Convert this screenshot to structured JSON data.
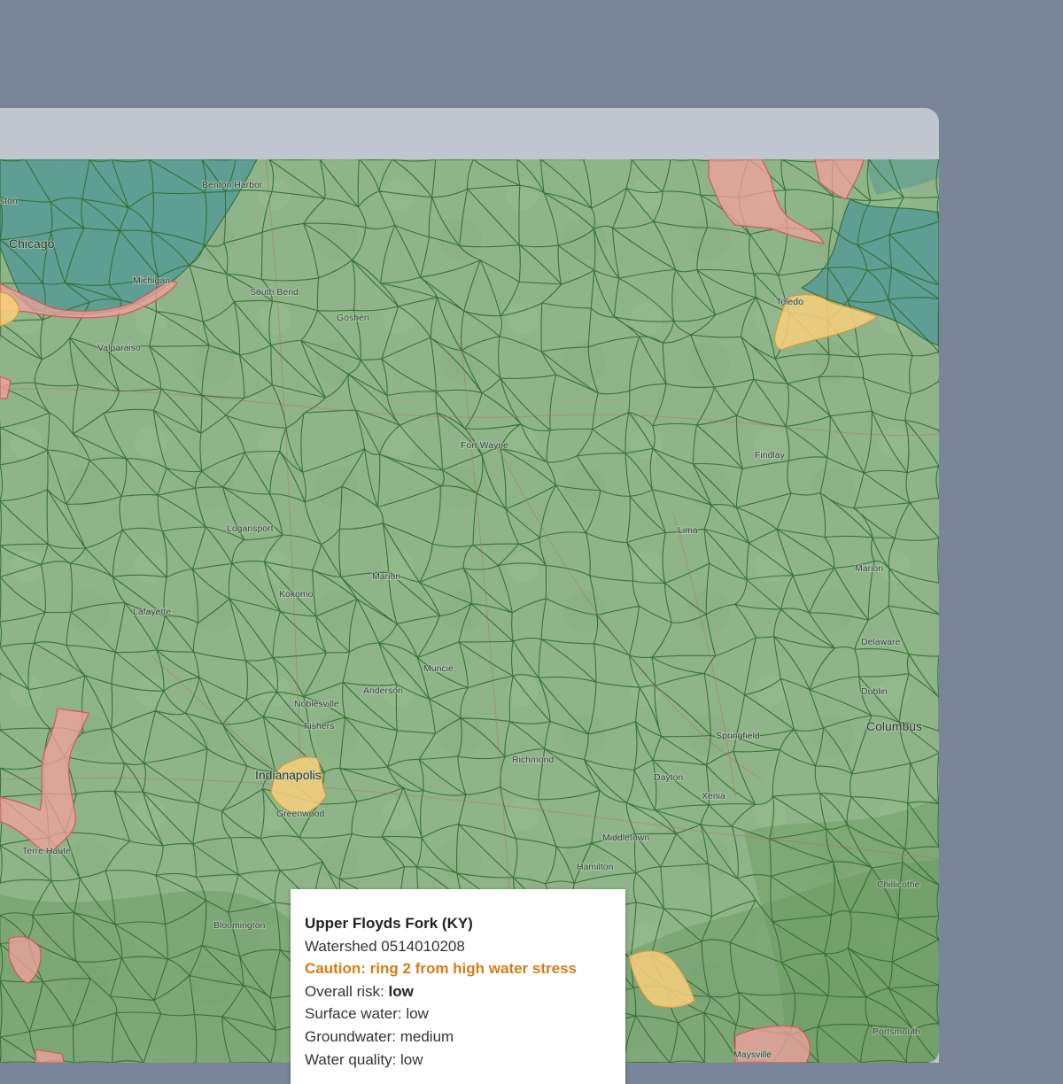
{
  "map": {
    "colors": {
      "base": "#8fb489",
      "lake": "#5e9e93",
      "boundary": "#2f6b2f",
      "high_stress": "#f4a0a0",
      "caution": "#f9cf7f"
    },
    "places": [
      {
        "name": "Benton Harbor"
      },
      {
        "name": "ston"
      },
      {
        "name": "Chicago"
      },
      {
        "name": "Michigan"
      },
      {
        "name": "South Bend"
      },
      {
        "name": "Goshen"
      },
      {
        "name": "Valparaiso"
      },
      {
        "name": "Toledo"
      },
      {
        "name": "Fort Wayne"
      },
      {
        "name": "Findlay"
      },
      {
        "name": "Logansport"
      },
      {
        "name": "Lima"
      },
      {
        "name": "Marion"
      },
      {
        "name": "Kokomo"
      },
      {
        "name": "Marion"
      },
      {
        "name": "Lafayette"
      },
      {
        "name": "Delaware"
      },
      {
        "name": "Muncie"
      },
      {
        "name": "Anderson"
      },
      {
        "name": "Dublin"
      },
      {
        "name": "Noblesville"
      },
      {
        "name": "Columbus"
      },
      {
        "name": "Fishers"
      },
      {
        "name": "Springfield"
      },
      {
        "name": "Richmond"
      },
      {
        "name": "Indianapolis"
      },
      {
        "name": "Dayton"
      },
      {
        "name": "Greenwood"
      },
      {
        "name": "Xenia"
      },
      {
        "name": "Middletown"
      },
      {
        "name": "Terre Haute"
      },
      {
        "name": "Hamilton"
      },
      {
        "name": "Chillicothe"
      },
      {
        "name": "Bloomington"
      },
      {
        "name": "Portsmouth"
      },
      {
        "name": "Maysville"
      }
    ]
  },
  "popup": {
    "title": "Upper Floyds Fork (KY)",
    "watershed": "Watershed 0514010208",
    "caution": "Caution: ring 2 from high water stress",
    "overall_label": "Overall risk:",
    "overall_value": "low",
    "surface": "Surface water: low",
    "groundwater": "Groundwater: medium",
    "quality": "Water quality: low"
  }
}
